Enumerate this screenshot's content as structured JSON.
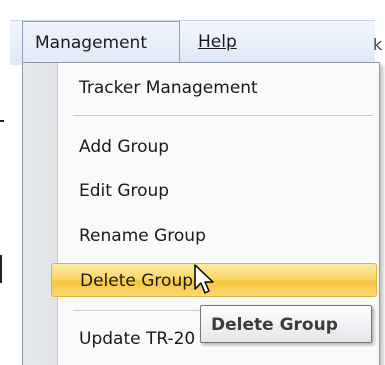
{
  "menubar": {
    "management_label": "Management",
    "help_label": "Help"
  },
  "background": {
    "text_fragment": "k"
  },
  "dropdown": {
    "items": [
      {
        "label": "Tracker Management"
      },
      {
        "label": "Add Group"
      },
      {
        "label": "Edit Group"
      },
      {
        "label": "Rename Group"
      },
      {
        "label": "Delete Group"
      },
      {
        "label": "Update TR-20"
      }
    ],
    "highlighted_item": "Delete Group"
  },
  "tooltip": {
    "text": "Delete Group"
  },
  "colors": {
    "highlight": "#fcd86a",
    "menubar": "#dde8f6",
    "gutter": "#e3e7ea"
  },
  "icons": {
    "cursor": "mouse-pointer-icon"
  }
}
